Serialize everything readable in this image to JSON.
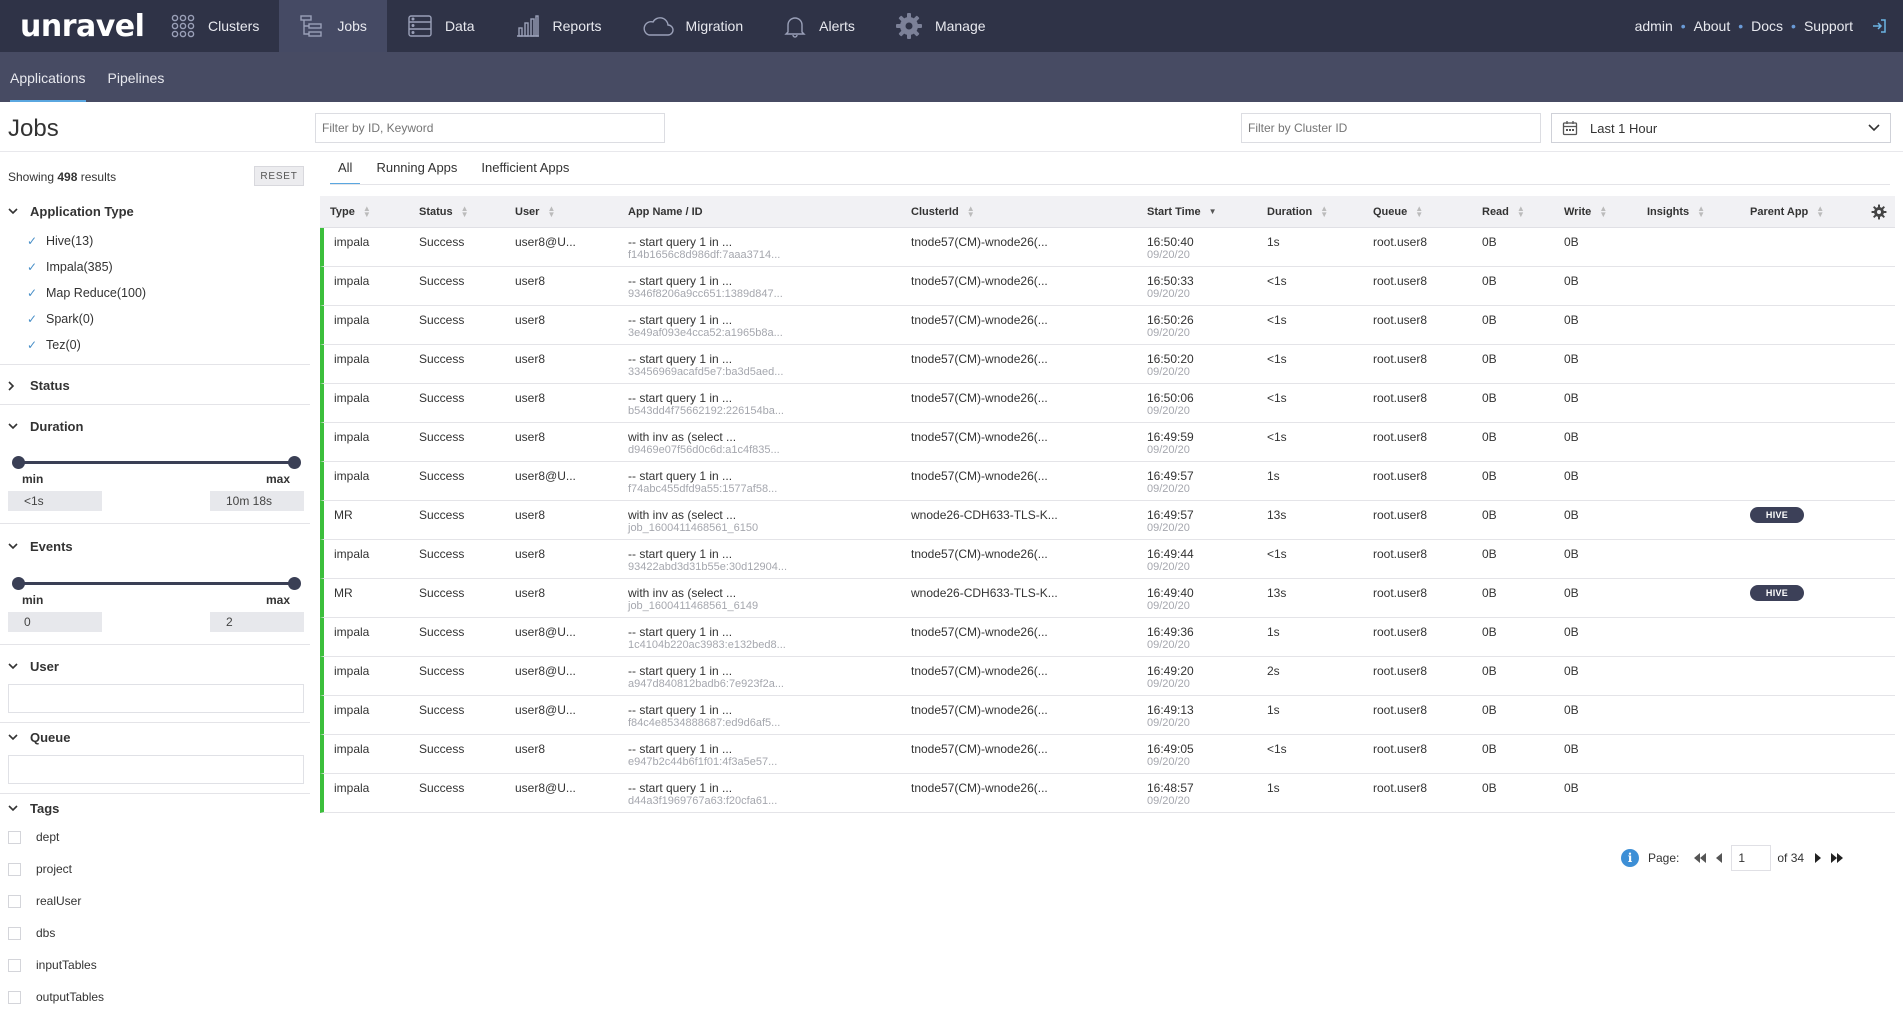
{
  "brand": "unravel",
  "nav": {
    "items": [
      {
        "label": "Clusters",
        "icon": "clusters-icon"
      },
      {
        "label": "Jobs",
        "icon": "jobs-icon"
      },
      {
        "label": "Data",
        "icon": "data-icon"
      },
      {
        "label": "Reports",
        "icon": "reports-icon"
      },
      {
        "label": "Migration",
        "icon": "cloud-icon"
      },
      {
        "label": "Alerts",
        "icon": "bell-icon"
      },
      {
        "label": "Manage",
        "icon": "gear-icon"
      }
    ],
    "active": "Jobs",
    "right": {
      "user": "admin",
      "about": "About",
      "docs": "Docs",
      "support": "Support"
    }
  },
  "subnav": {
    "tabs": [
      "Applications",
      "Pipelines"
    ],
    "active": "Applications"
  },
  "page_title": "Jobs",
  "filters": {
    "keyword_placeholder": "Filter by ID, Keyword",
    "cluster_placeholder": "Filter by Cluster ID",
    "time_range": "Last 1 Hour"
  },
  "sidebar": {
    "showing_prefix": "Showing",
    "showing_count": "498",
    "showing_suffix": "results",
    "reset": "RESET",
    "app_type": {
      "title": "Application Type",
      "items": [
        "Hive(13)",
        "Impala(385)",
        "Map Reduce(100)",
        "Spark(0)",
        "Tez(0)"
      ]
    },
    "status": {
      "title": "Status"
    },
    "duration": {
      "title": "Duration",
      "min_label": "min",
      "max_label": "max",
      "min_value": "<1s",
      "max_value": "10m 18s"
    },
    "events": {
      "title": "Events",
      "min_label": "min",
      "max_label": "max",
      "min_value": "0",
      "max_value": "2"
    },
    "user": {
      "title": "User"
    },
    "queue": {
      "title": "Queue"
    },
    "tags": {
      "title": "Tags",
      "items": [
        "dept",
        "project",
        "realUser",
        "dbs",
        "inputTables",
        "outputTables"
      ]
    }
  },
  "tabs": [
    "All",
    "Running Apps",
    "Inefficient Apps"
  ],
  "active_tab": "All",
  "table": {
    "columns": [
      "Type",
      "Status",
      "User",
      "App Name / ID",
      "ClusterId",
      "Start Time",
      "Duration",
      "Queue",
      "Read",
      "Write",
      "Insights",
      "Parent App"
    ],
    "rows": [
      {
        "type": "impala",
        "status": "Success",
        "user": "user8@U...",
        "app": "-- start query 1 in ...",
        "id": "f14b1656c8d986df:7aaa3714...",
        "cluster": "tnode57(CM)-wnode26(...",
        "time": "16:50:40",
        "date": "09/20/20",
        "duration": "1s",
        "queue": "root.user8",
        "read": "0B",
        "write": "0B",
        "parent": ""
      },
      {
        "type": "impala",
        "status": "Success",
        "user": "user8",
        "app": "-- start query 1 in ...",
        "id": "9346f8206a9cc651:1389d847...",
        "cluster": "tnode57(CM)-wnode26(...",
        "time": "16:50:33",
        "date": "09/20/20",
        "duration": "<1s",
        "queue": "root.user8",
        "read": "0B",
        "write": "0B",
        "parent": ""
      },
      {
        "type": "impala",
        "status": "Success",
        "user": "user8",
        "app": "-- start query 1 in ...",
        "id": "3e49af093e4cca52:a1965b8a...",
        "cluster": "tnode57(CM)-wnode26(...",
        "time": "16:50:26",
        "date": "09/20/20",
        "duration": "<1s",
        "queue": "root.user8",
        "read": "0B",
        "write": "0B",
        "parent": ""
      },
      {
        "type": "impala",
        "status": "Success",
        "user": "user8",
        "app": "-- start query 1 in ...",
        "id": "33456969acafd5e7:ba3d5aed...",
        "cluster": "tnode57(CM)-wnode26(...",
        "time": "16:50:20",
        "date": "09/20/20",
        "duration": "<1s",
        "queue": "root.user8",
        "read": "0B",
        "write": "0B",
        "parent": ""
      },
      {
        "type": "impala",
        "status": "Success",
        "user": "user8",
        "app": "-- start query 1 in ...",
        "id": "b543dd4f75662192:226154ba...",
        "cluster": "tnode57(CM)-wnode26(...",
        "time": "16:50:06",
        "date": "09/20/20",
        "duration": "<1s",
        "queue": "root.user8",
        "read": "0B",
        "write": "0B",
        "parent": ""
      },
      {
        "type": "impala",
        "status": "Success",
        "user": "user8",
        "app": "with inv as (select ...",
        "id": "d9469e07f56d0c6d:a1c4f835...",
        "cluster": "tnode57(CM)-wnode26(...",
        "time": "16:49:59",
        "date": "09/20/20",
        "duration": "<1s",
        "queue": "root.user8",
        "read": "0B",
        "write": "0B",
        "parent": ""
      },
      {
        "type": "impala",
        "status": "Success",
        "user": "user8@U...",
        "app": "-- start query 1 in ...",
        "id": "f74abc455dfd9a55:1577af58...",
        "cluster": "tnode57(CM)-wnode26(...",
        "time": "16:49:57",
        "date": "09/20/20",
        "duration": "1s",
        "queue": "root.user8",
        "read": "0B",
        "write": "0B",
        "parent": ""
      },
      {
        "type": "MR",
        "status": "Success",
        "user": "user8",
        "app": "with inv as (select ...",
        "id": "job_1600411468561_6150",
        "cluster": "wnode26-CDH633-TLS-K...",
        "time": "16:49:57",
        "date": "09/20/20",
        "duration": "13s",
        "queue": "root.user8",
        "read": "0B",
        "write": "0B",
        "parent": "HIVE"
      },
      {
        "type": "impala",
        "status": "Success",
        "user": "user8",
        "app": "-- start query 1 in ...",
        "id": "93422abd3d31b55e:30d12904...",
        "cluster": "tnode57(CM)-wnode26(...",
        "time": "16:49:44",
        "date": "09/20/20",
        "duration": "<1s",
        "queue": "root.user8",
        "read": "0B",
        "write": "0B",
        "parent": ""
      },
      {
        "type": "MR",
        "status": "Success",
        "user": "user8",
        "app": "with inv as (select ...",
        "id": "job_1600411468561_6149",
        "cluster": "wnode26-CDH633-TLS-K...",
        "time": "16:49:40",
        "date": "09/20/20",
        "duration": "13s",
        "queue": "root.user8",
        "read": "0B",
        "write": "0B",
        "parent": "HIVE"
      },
      {
        "type": "impala",
        "status": "Success",
        "user": "user8@U...",
        "app": "-- start query 1 in ...",
        "id": "1c4104b220ac3983:e132bed8...",
        "cluster": "tnode57(CM)-wnode26(...",
        "time": "16:49:36",
        "date": "09/20/20",
        "duration": "1s",
        "queue": "root.user8",
        "read": "0B",
        "write": "0B",
        "parent": ""
      },
      {
        "type": "impala",
        "status": "Success",
        "user": "user8@U...",
        "app": "-- start query 1 in ...",
        "id": "a947d840812badb6:7e923f2a...",
        "cluster": "tnode57(CM)-wnode26(...",
        "time": "16:49:20",
        "date": "09/20/20",
        "duration": "2s",
        "queue": "root.user8",
        "read": "0B",
        "write": "0B",
        "parent": ""
      },
      {
        "type": "impala",
        "status": "Success",
        "user": "user8@U...",
        "app": "-- start query 1 in ...",
        "id": "f84c4e8534888687:ed9d6af5...",
        "cluster": "tnode57(CM)-wnode26(...",
        "time": "16:49:13",
        "date": "09/20/20",
        "duration": "1s",
        "queue": "root.user8",
        "read": "0B",
        "write": "0B",
        "parent": ""
      },
      {
        "type": "impala",
        "status": "Success",
        "user": "user8",
        "app": "-- start query 1 in ...",
        "id": "e947b2c44b6f1f01:4f3a5e57...",
        "cluster": "tnode57(CM)-wnode26(...",
        "time": "16:49:05",
        "date": "09/20/20",
        "duration": "<1s",
        "queue": "root.user8",
        "read": "0B",
        "write": "0B",
        "parent": ""
      },
      {
        "type": "impala",
        "status": "Success",
        "user": "user8@U...",
        "app": "-- start query 1 in ...",
        "id": "d44a3f1969767a63:f20cfa61...",
        "cluster": "tnode57(CM)-wnode26(...",
        "time": "16:48:57",
        "date": "09/20/20",
        "duration": "1s",
        "queue": "root.user8",
        "read": "0B",
        "write": "0B",
        "parent": ""
      }
    ]
  },
  "pagination": {
    "label": "Page:",
    "current": "1",
    "total": "of 34"
  },
  "colors": {
    "nav_bg": "#2f3347",
    "subnav_bg": "#474b63",
    "accent": "#5aa7e0",
    "success": "#3cbf3c",
    "badge": "#3c4058"
  }
}
